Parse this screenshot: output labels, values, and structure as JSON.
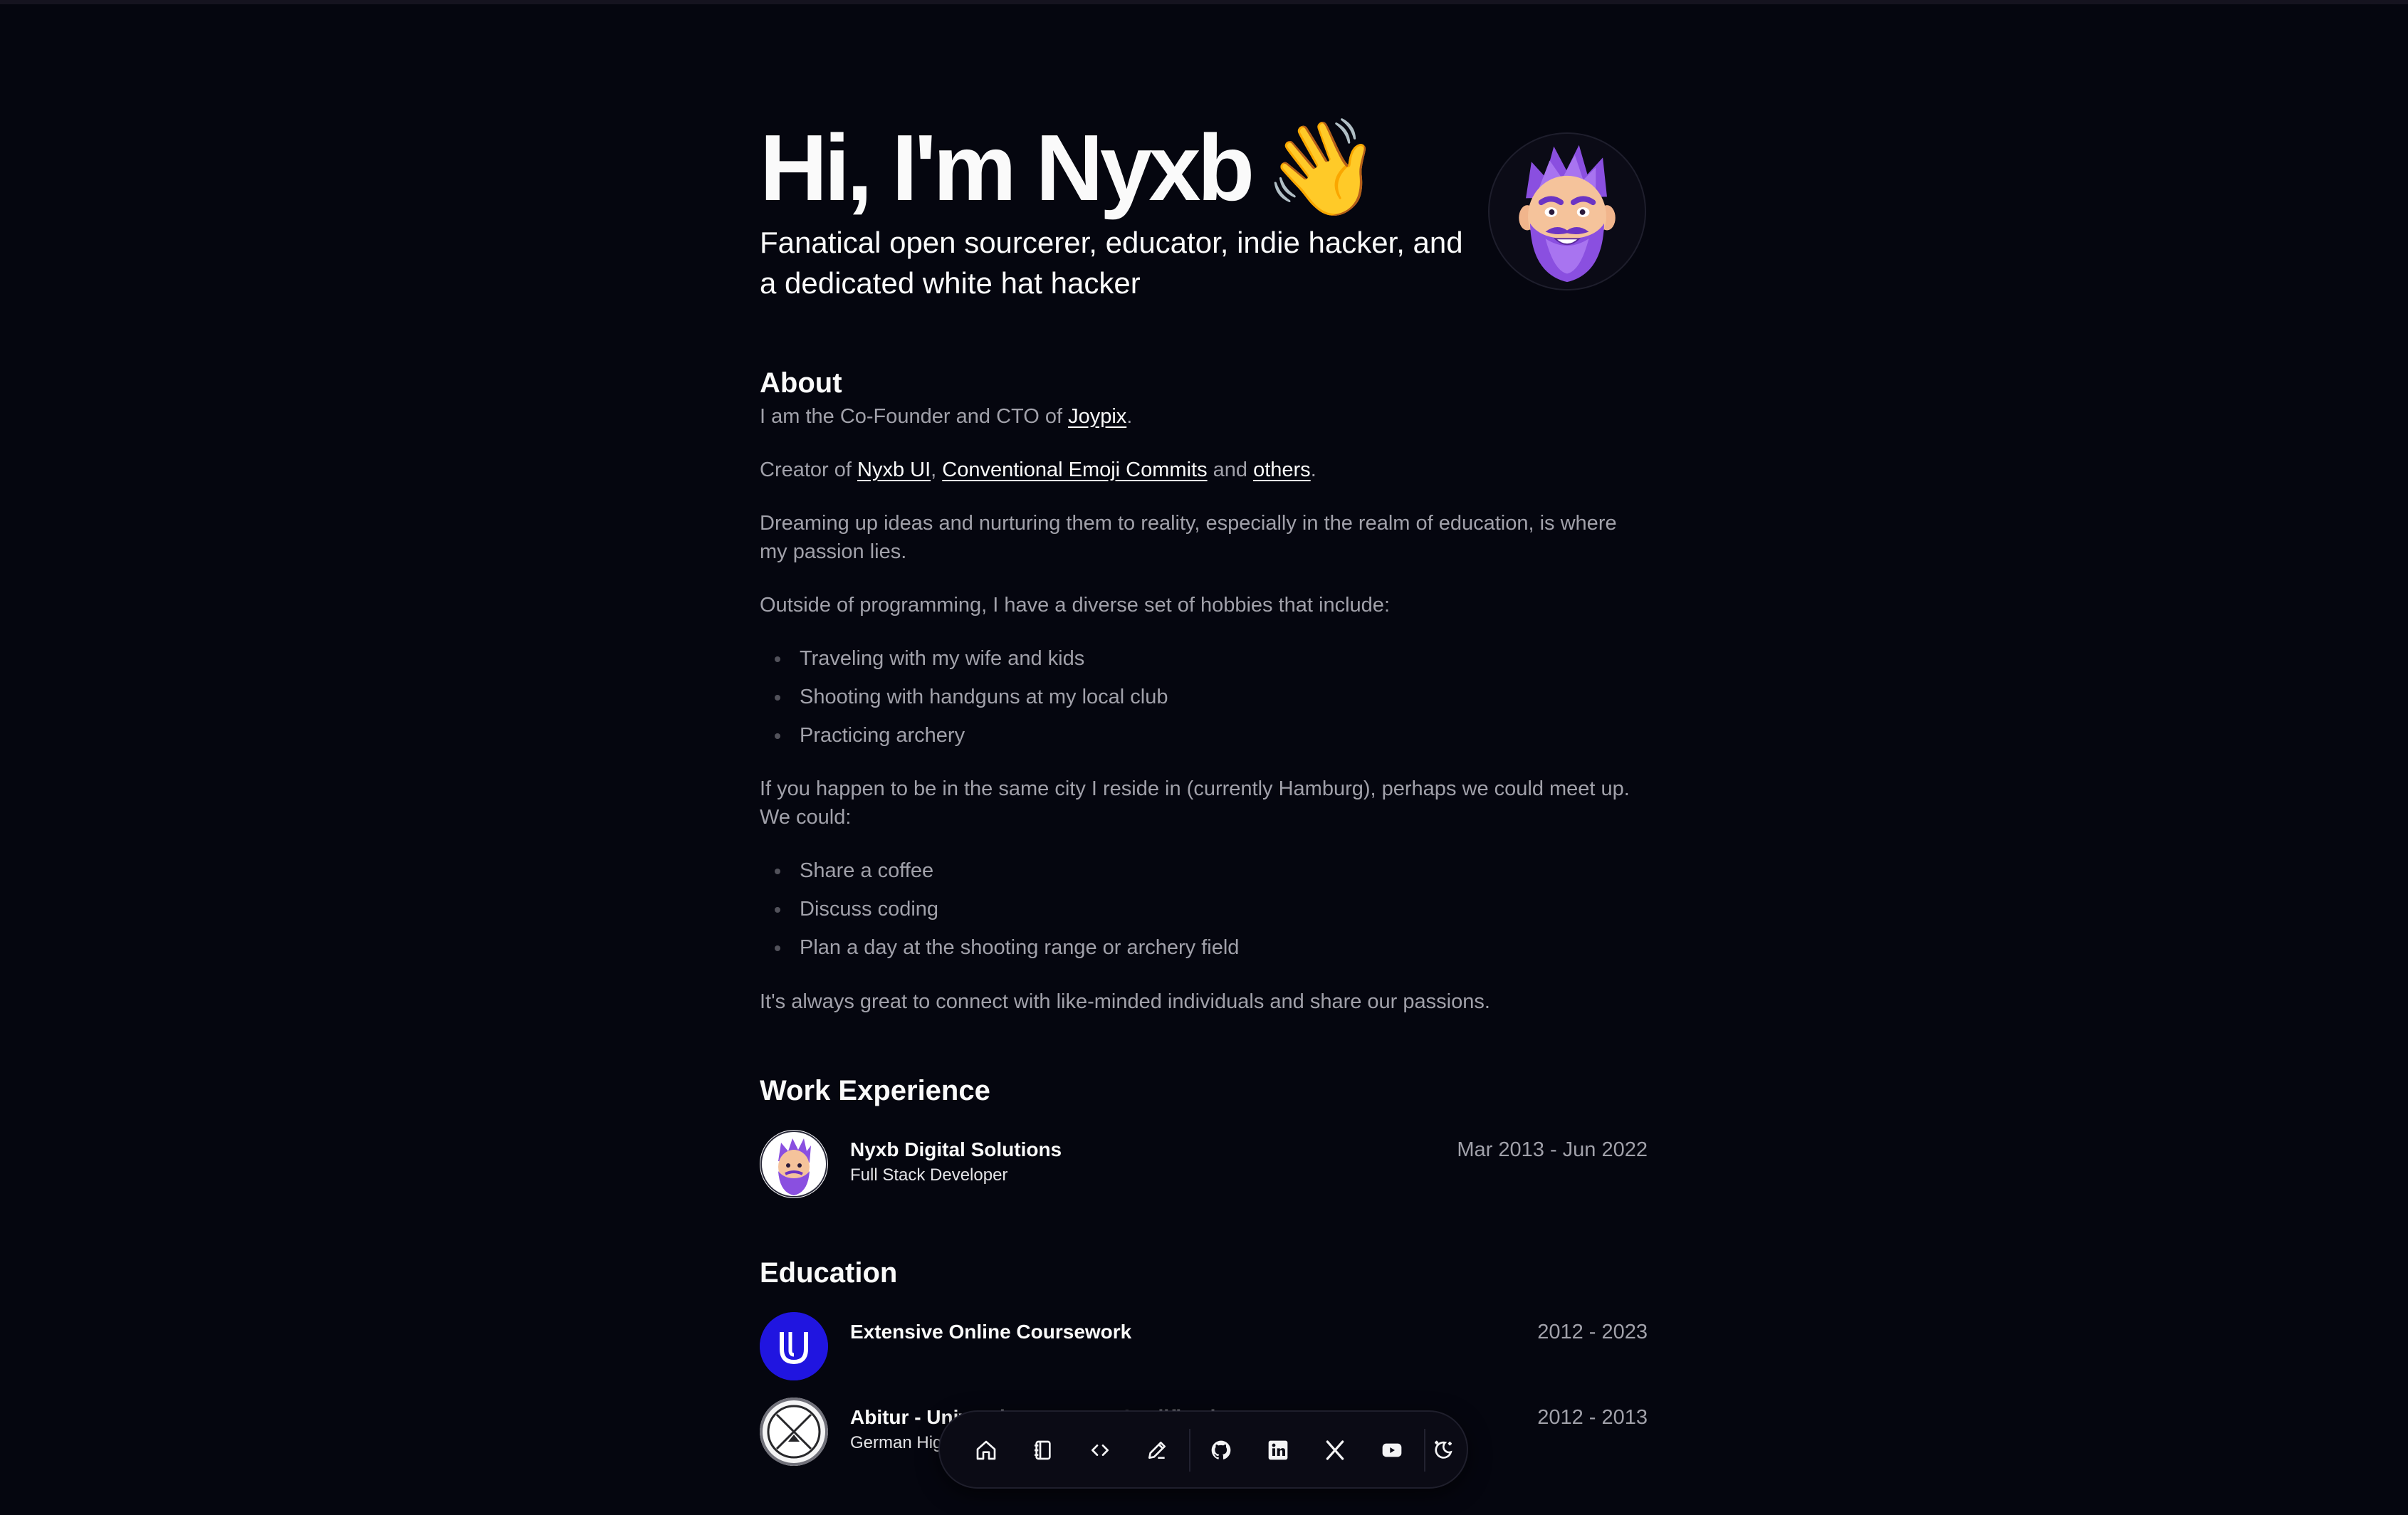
{
  "hero": {
    "title": "Hi, I'm Nyxb",
    "emoji": "👋",
    "subtitle": "Fanatical open sourcerer, educator, indie hacker, and a dedicated white hat hacker",
    "avatar_icon": "avatar-purple-bearded-character"
  },
  "about": {
    "heading": "About",
    "p1_prefix": "I am the Co-Founder and CTO of ",
    "p1_link": "Joypix",
    "p1_suffix": ".",
    "p2_prefix": "Creator of ",
    "p2_link1": "Nyxb UI",
    "p2_sep": ", ",
    "p2_link2": "Conventional Emoji Commits",
    "p2_and": " and ",
    "p2_link3": "others",
    "p2_suffix": ".",
    "p3": "Dreaming up ideas and nurturing them to reality, especially in the realm of education, is where my passion lies.",
    "p4": "Outside of programming, I have a diverse set of hobbies that include:",
    "hobbies": [
      "Traveling with my wife and kids",
      "Shooting with handguns at my local club",
      "Practicing archery"
    ],
    "p5": "If you happen to be in the same city I reside in (currently Hamburg), perhaps we could meet up. We could:",
    "meetups": [
      "Share a coffee",
      "Discuss coding",
      "Plan a day at the shooting range or archery field"
    ],
    "p6": "It's always great to connect with like-minded individuals and share our passions."
  },
  "work": {
    "heading": "Work Experience",
    "items": [
      {
        "name": "Nyxb Digital Solutions",
        "role": "Full Stack Developer",
        "dates": "Mar 2013 - Jun 2022"
      }
    ]
  },
  "education": {
    "heading": "Education",
    "items": [
      {
        "name": "Extensive Online Coursework",
        "role": "",
        "dates": "2012 - 2023"
      },
      {
        "name": "Abitur - University Entrance Qualification",
        "role": "German High School",
        "dates": "2012 - 2013"
      }
    ]
  },
  "dock": {
    "items": [
      "home-icon",
      "notebook-icon",
      "code-icon",
      "pencil-icon",
      "github-icon",
      "linkedin-icon",
      "x-icon",
      "youtube-icon",
      "theme-toggle-icon"
    ]
  },
  "colors": {
    "background": "#05060f",
    "text": "#fafafa",
    "muted": "#a1a1aa",
    "avatar_purple": "#7c4dcf",
    "udacity_blue": "#2015e0"
  }
}
